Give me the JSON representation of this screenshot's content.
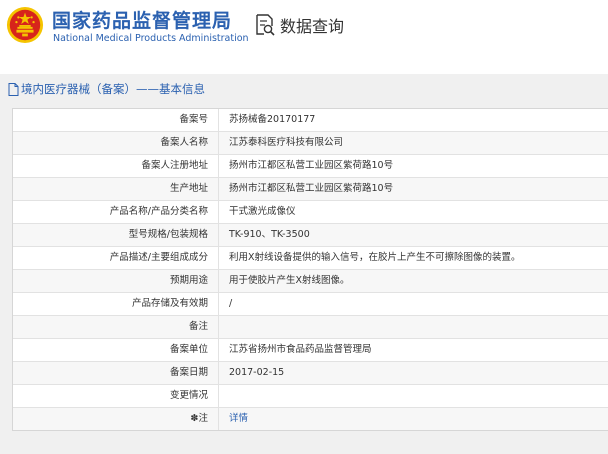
{
  "header": {
    "org_name_cn": "国家药品监督管理局",
    "org_name_en": "National Medical Products Administration",
    "search_label": "数据查询"
  },
  "colors": {
    "brand_blue": "#2b61b0",
    "emblem_red": "#d7241b",
    "emblem_gold": "#f5c400"
  },
  "panel": {
    "title": "境内医疗器械（备案）——基本信息",
    "rows": [
      {
        "label": "备案号",
        "value": "苏扬械备20170177"
      },
      {
        "label": "备案人名称",
        "value": "江苏泰科医疗科技有限公司"
      },
      {
        "label": "备案人注册地址",
        "value": "扬州市江都区私营工业园区紫荷路10号"
      },
      {
        "label": "生产地址",
        "value": "扬州市江都区私营工业园区紫荷路10号"
      },
      {
        "label": "产品名称/产品分类名称",
        "value": "干式激光成像仪"
      },
      {
        "label": "型号规格/包装规格",
        "value": "TK-910、TK-3500"
      },
      {
        "label": "产品描述/主要组成成分",
        "value": "利用X射线设备提供的输入信号，在胶片上产生不可擦除图像的装置。"
      },
      {
        "label": "预期用途",
        "value": "用于使胶片产生X射线图像。"
      },
      {
        "label": "产品存储及有效期",
        "value": "/"
      },
      {
        "label": "备注",
        "value": ""
      },
      {
        "label": "备案单位",
        "value": "江苏省扬州市食品药品监督管理局"
      },
      {
        "label": "备案日期",
        "value": "2017-02-15"
      },
      {
        "label": "变更情况",
        "value": ""
      },
      {
        "label": "注",
        "value": "详情",
        "icon": "note-icon"
      }
    ]
  }
}
